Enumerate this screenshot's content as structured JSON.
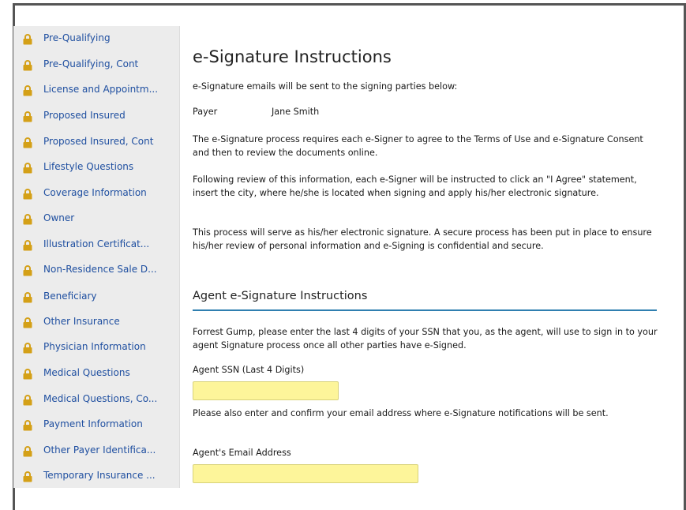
{
  "sidebar": {
    "items": [
      {
        "label": "Pre-Qualifying"
      },
      {
        "label": "Pre-Qualifying, Cont"
      },
      {
        "label": "License and Appointm..."
      },
      {
        "label": "Proposed Insured"
      },
      {
        "label": "Proposed Insured, Cont"
      },
      {
        "label": "Lifestyle Questions"
      },
      {
        "label": "Coverage Information"
      },
      {
        "label": "Owner"
      },
      {
        "label": "Illustration Certificat..."
      },
      {
        "label": "Non-Residence Sale D..."
      },
      {
        "label": "Beneficiary"
      },
      {
        "label": "Other Insurance"
      },
      {
        "label": "Physician Information"
      },
      {
        "label": "Medical Questions"
      },
      {
        "label": "Medical Questions, Co..."
      },
      {
        "label": "Payment Information"
      },
      {
        "label": "Other Payer Identifica..."
      },
      {
        "label": "Temporary Insurance ..."
      }
    ],
    "icon": "lock-icon",
    "icon_color": "#d4a017",
    "label_color": "#1f4fa0"
  },
  "main": {
    "title": "e-Signature Instructions",
    "intro": "e-Signature emails will be sent to the signing parties below:",
    "payer_label": "Payer",
    "payer_name": "Jane Smith",
    "para1": "The e-Signature process requires each e-Signer to agree to the Terms of Use and e-Signature Consent and then to review the documents online.",
    "para2": "Following review of this information, each e-Signer will be instructed to click an \"I Agree\" statement, insert the city, where he/she is located when signing and apply his/her electronic signature.",
    "para3": "This process will serve as his/her electronic signature. A secure process has been put in place to ensure his/her review of personal information and e-Signing is confidential and secure.",
    "agent_section_title": "Agent e-Signature Instructions",
    "agent_para": "Forrest Gump, please enter the last 4 digits of your SSN that you, as the agent, will use to sign in to your agent Signature process once all other parties have e-Signed.",
    "ssn_label": "Agent SSN (Last 4 Digits)",
    "ssn_value": "",
    "email_para": "Please also enter and confirm your email address where e-Signature notifications will be sent.",
    "email_label": "Agent's Email Address",
    "email_value": ""
  },
  "colors": {
    "accent_rule": "#2f7fb0",
    "input_bg": "#fdf59a"
  }
}
